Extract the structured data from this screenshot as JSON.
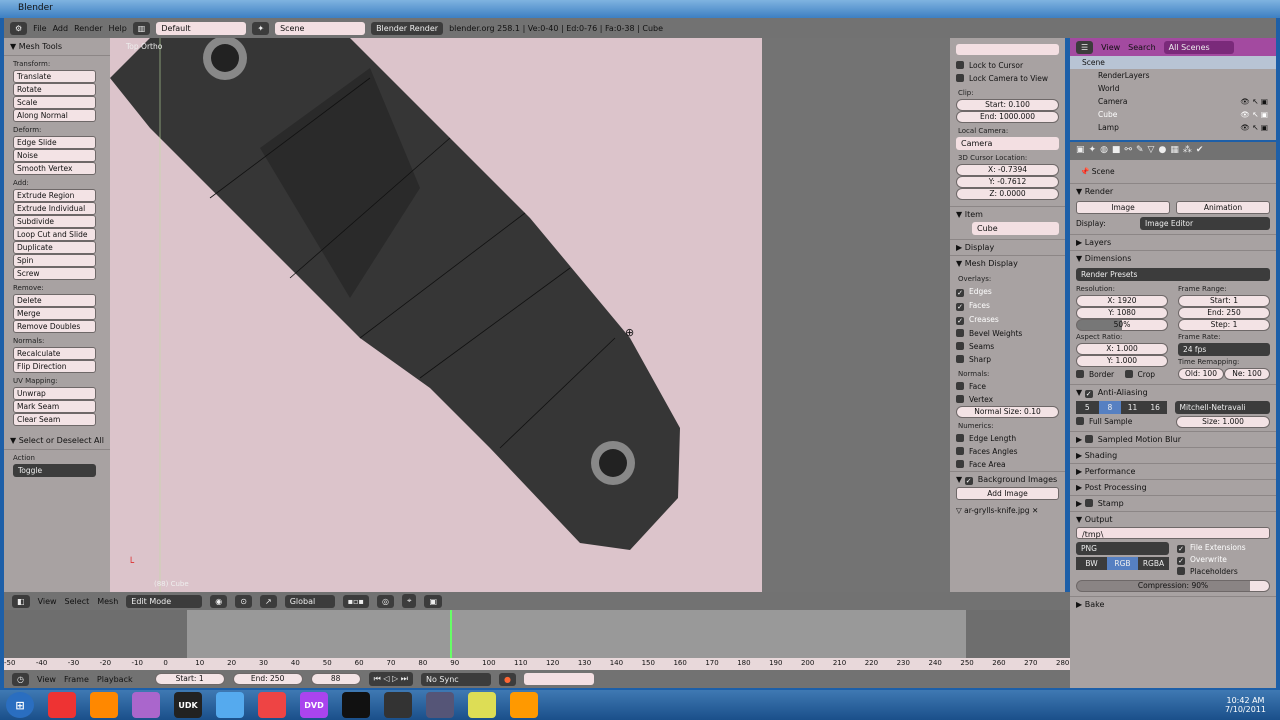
{
  "window": {
    "title": "Blender"
  },
  "header": {
    "menus": [
      "File",
      "Add",
      "Render",
      "Help"
    ],
    "layout": "Default",
    "scene": "Scene",
    "engine": "Blender Render",
    "info": "blender.org 258.1 | Ve:0-40 | Ed:0-76 | Fa:0-38 | Cube"
  },
  "toolbar": {
    "title": "Mesh Tools",
    "groups": [
      {
        "label": "Transform:",
        "items": [
          "Translate",
          "Rotate",
          "Scale",
          "Along Normal"
        ]
      },
      {
        "label": "Deform:",
        "items": [
          "Edge Slide",
          "Noise",
          "Smooth Vertex"
        ]
      },
      {
        "label": "Add:",
        "items": [
          "Extrude Region",
          "Extrude Individual",
          "Subdivide",
          "Loop Cut and Slide",
          "Duplicate",
          "Spin",
          "Screw"
        ]
      },
      {
        "label": "Remove:",
        "items": [
          "Delete",
          "Merge",
          "Remove Doubles"
        ]
      },
      {
        "label": "Normals:",
        "items": [
          "Recalculate",
          "Flip Direction"
        ]
      },
      {
        "label": "UV Mapping:",
        "items": [
          "Unwrap",
          "Mark Seam",
          "Clear Seam"
        ]
      }
    ],
    "operator": {
      "title": "Select or Deselect All",
      "action_label": "Action",
      "action": "Toggle"
    }
  },
  "viewport": {
    "view_label": "Top Ortho",
    "object_label": "(88) Cube"
  },
  "npanel": {
    "lock_cursor": "Lock to Cursor",
    "lock_camera": "Lock Camera to View",
    "clip_label": "Clip:",
    "clip_start": "Start: 0.100",
    "clip_end": "End: 1000.000",
    "local_camera_label": "Local Camera:",
    "local_camera": "Camera",
    "cursor_label": "3D Cursor Location:",
    "cursor_x": "X: -0.7394",
    "cursor_y": "Y: -0.7612",
    "cursor_z": "Z: 0.0000",
    "item_title": "Item",
    "item_name": "Cube",
    "display_title": "Display",
    "mesh_display_title": "Mesh Display",
    "overlays_label": "Overlays:",
    "overlays": [
      {
        "label": "Edges",
        "checked": true
      },
      {
        "label": "Faces",
        "checked": true
      },
      {
        "label": "Creases",
        "checked": true
      },
      {
        "label": "Bevel Weights",
        "checked": false
      },
      {
        "label": "Seams",
        "checked": false
      },
      {
        "label": "Sharp",
        "checked": false
      }
    ],
    "normals_label": "Normals:",
    "normals": [
      {
        "label": "Face",
        "checked": false
      },
      {
        "label": "Vertex",
        "checked": false
      }
    ],
    "normal_size": "Normal Size: 0.10",
    "numerics_label": "Numerics:",
    "numerics": [
      {
        "label": "Edge Length",
        "checked": false
      },
      {
        "label": "Faces Angles",
        "checked": false
      },
      {
        "label": "Face Area",
        "checked": false
      }
    ],
    "bg_images_title": "Background Images",
    "add_image": "Add Image",
    "bg_image_file": "ar-grylls-knife.jpg"
  },
  "outliner": {
    "view": "View",
    "search": "Search",
    "filter": "All Scenes",
    "items": [
      {
        "name": "Scene",
        "indent": 0
      },
      {
        "name": "RenderLayers",
        "indent": 1
      },
      {
        "name": "World",
        "indent": 1
      },
      {
        "name": "Camera",
        "indent": 1
      },
      {
        "name": "Cube",
        "indent": 1
      },
      {
        "name": "Lamp",
        "indent": 1
      }
    ]
  },
  "props": {
    "context": "Scene",
    "render_title": "Render",
    "image_btn": "Image",
    "animation_btn": "Animation",
    "display_label": "Display:",
    "display_value": "Image Editor",
    "layers": "Layers",
    "dimensions": "Dimensions",
    "render_presets": "Render Presets",
    "resolution_label": "Resolution:",
    "res_x": "X: 1920",
    "res_y": "Y: 1080",
    "res_pct": "50%",
    "res_pct_value": 50,
    "frame_range_label": "Frame Range:",
    "start": "Start: 1",
    "end": "End: 250",
    "step": "Step: 1",
    "aspect_label": "Aspect Ratio:",
    "aspect_x": "X: 1.000",
    "aspect_y": "Y: 1.000",
    "frame_rate_label": "Frame Rate:",
    "frame_rate": "24 fps",
    "border": "Border",
    "crop": "Crop",
    "time_remap_label": "Time Remapping:",
    "old": "Old: 100",
    "new": "Ne: 100",
    "aa_title": "Anti-Aliasing",
    "aa_samples": [
      "5",
      "8",
      "11",
      "16"
    ],
    "aa_selected": "8",
    "aa_filter": "Mitchell-Netravali",
    "full_sample": "Full Sample",
    "aa_size": "Size: 1.000",
    "collapsed": [
      "Sampled Motion Blur",
      "Shading",
      "Performance",
      "Post Processing",
      "Stamp"
    ],
    "output_title": "Output",
    "output_path": "/tmp\\",
    "format": "PNG",
    "color_modes": [
      "BW",
      "RGB",
      "RGBA"
    ],
    "color_selected": "RGB",
    "file_ext": "File Extensions",
    "overwrite": "Overwrite",
    "placeholders": "Placeholders",
    "compression": "Compression: 90%",
    "compression_value": 90,
    "bake": "Bake"
  },
  "v3d_header": {
    "menus": [
      "View",
      "Select",
      "Mesh"
    ],
    "mode": "Edit Mode",
    "orientation": "Global"
  },
  "timeline": {
    "ticks": [
      "-50",
      "-40",
      "-30",
      "-20",
      "-10",
      "0",
      "10",
      "20",
      "30",
      "40",
      "50",
      "60",
      "70",
      "80",
      "90",
      "100",
      "110",
      "120",
      "130",
      "140",
      "150",
      "160",
      "170",
      "180",
      "190",
      "200",
      "210",
      "220",
      "230",
      "240",
      "250",
      "260",
      "270",
      "280"
    ],
    "current_frame_value": 88,
    "menus": [
      "View",
      "Frame",
      "Playback"
    ],
    "start": "Start: 1",
    "end": "End: 250",
    "current": "88",
    "sync": "No Sync"
  },
  "taskbar": {
    "apps": [
      "chrome",
      "firefox",
      "app",
      "UDK",
      "cube",
      "app",
      "DVD",
      "inkscape",
      "app",
      "app",
      "app",
      "blender"
    ],
    "time": "10:42 AM",
    "date": "7/10/2011"
  }
}
